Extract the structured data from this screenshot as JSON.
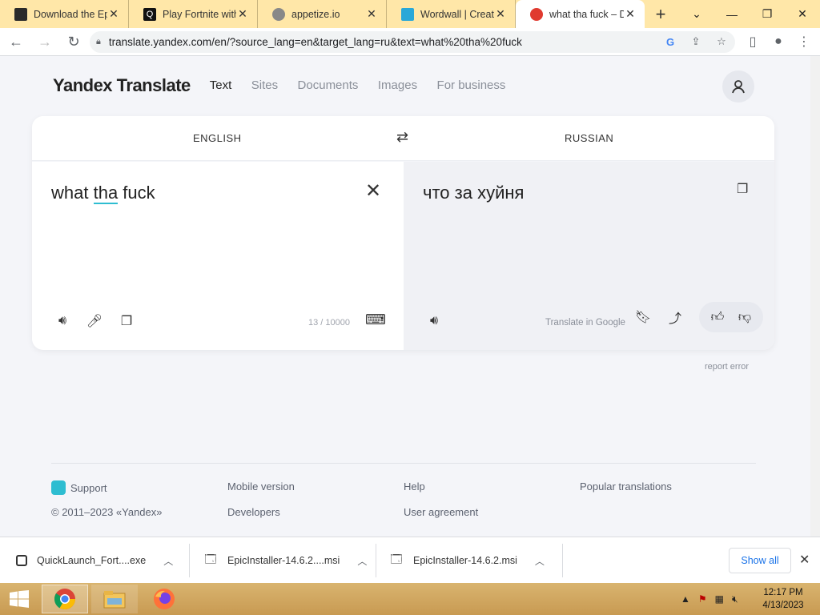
{
  "browser": {
    "tabs": [
      {
        "title": "Download the Ep",
        "active": false
      },
      {
        "title": "Play Fortnite with",
        "active": false
      },
      {
        "title": "appetize.io",
        "active": false
      },
      {
        "title": "Wordwall | Create",
        "active": false
      },
      {
        "title": "what tha fuck – D",
        "active": true
      }
    ],
    "url": "translate.yandex.com/en/?source_lang=en&target_lang=ru&text=what%20tha%20fuck"
  },
  "site": {
    "logo": "Yandex Translate",
    "nav": [
      "Text",
      "Sites",
      "Documents",
      "Images",
      "For business"
    ],
    "active_nav": "Text"
  },
  "translator": {
    "source_lang": "ENGLISH",
    "target_lang": "RUSSIAN",
    "source_text_pre": "what ",
    "source_text_underlined": "tha",
    "source_text_post": " fuck",
    "translation": "что за хуйня",
    "counter": "13 / 10000",
    "translate_in_google": "Translate in Google",
    "report_error": "report error"
  },
  "footer": {
    "support": "Support",
    "copyright": "© 2011–2023 «Yandex»",
    "mobile_version": "Mobile version",
    "developers": "Developers",
    "help": "Help",
    "user_agreement": "User agreement",
    "popular_translations": "Popular translations"
  },
  "downloads": {
    "items": [
      "QuickLaunch_Fort....exe",
      "EpicInstaller-14.6.2....msi",
      "EpicInstaller-14.6.2.msi"
    ],
    "show_all": "Show all"
  },
  "taskbar": {
    "time": "12:17 PM",
    "date": "4/13/2023"
  },
  "colors": {
    "tabstrip": "#ffe7a8",
    "accent_underline": "#2ebdd1",
    "page_bg": "#f4f5f9"
  }
}
